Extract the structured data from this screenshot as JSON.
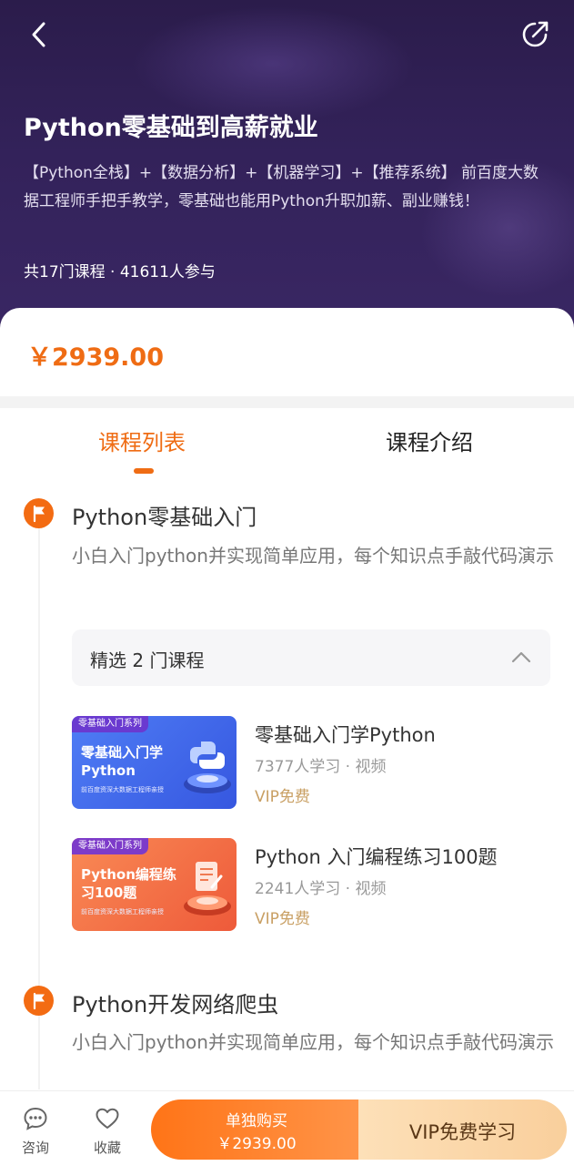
{
  "header": {
    "back_icon": "chevron-left-icon",
    "share_icon": "share-icon",
    "title": "Python零基础到高薪就业",
    "description": "【Python全栈】+【数据分析】+【机器学习】+【推荐系统】 前百度大数据工程师手把手教学，零基础也能用Python升职加薪、副业赚钱！",
    "meta": "共17门课程 · 41611人参与"
  },
  "price": "￥2939.00",
  "tabs": [
    {
      "label": "课程列表",
      "active": true
    },
    {
      "label": "课程介绍",
      "active": false
    }
  ],
  "sections": [
    {
      "title": "Python零基础入门",
      "description": "小白入门python并实现简单应用，每个知识点手敲代码演示",
      "dropdown_label": "精选 2 门课程",
      "courses": [
        {
          "thumb_tag": "零基础入门系列",
          "thumb_title": "零基础入门学Python",
          "thumb_sub": "前百度资深大数据工程师亲授",
          "title": "零基础入门学Python",
          "meta": "7377人学习 · 视频",
          "vip": "VIP免费"
        },
        {
          "thumb_tag": "零基础入门系列",
          "thumb_title": "Python编程练习100题",
          "thumb_sub": "前百度资深大数据工程师亲授",
          "title": "Python 入门编程练习100题",
          "meta": "2241人学习 · 视频",
          "vip": "VIP免费"
        }
      ]
    },
    {
      "title": "Python开发网络爬虫",
      "description": "小白入门python并实现简单应用，每个知识点手敲代码演示"
    }
  ],
  "bottom_bar": {
    "consult_label": "咨询",
    "favorite_label": "收藏",
    "buy_label": "单独购买",
    "buy_price": "￥2939.00",
    "vip_label": "VIP免费学习"
  },
  "colors": {
    "accent": "#ef6c14",
    "hero_bg": "#33225a",
    "vip_text": "#c9a064"
  }
}
